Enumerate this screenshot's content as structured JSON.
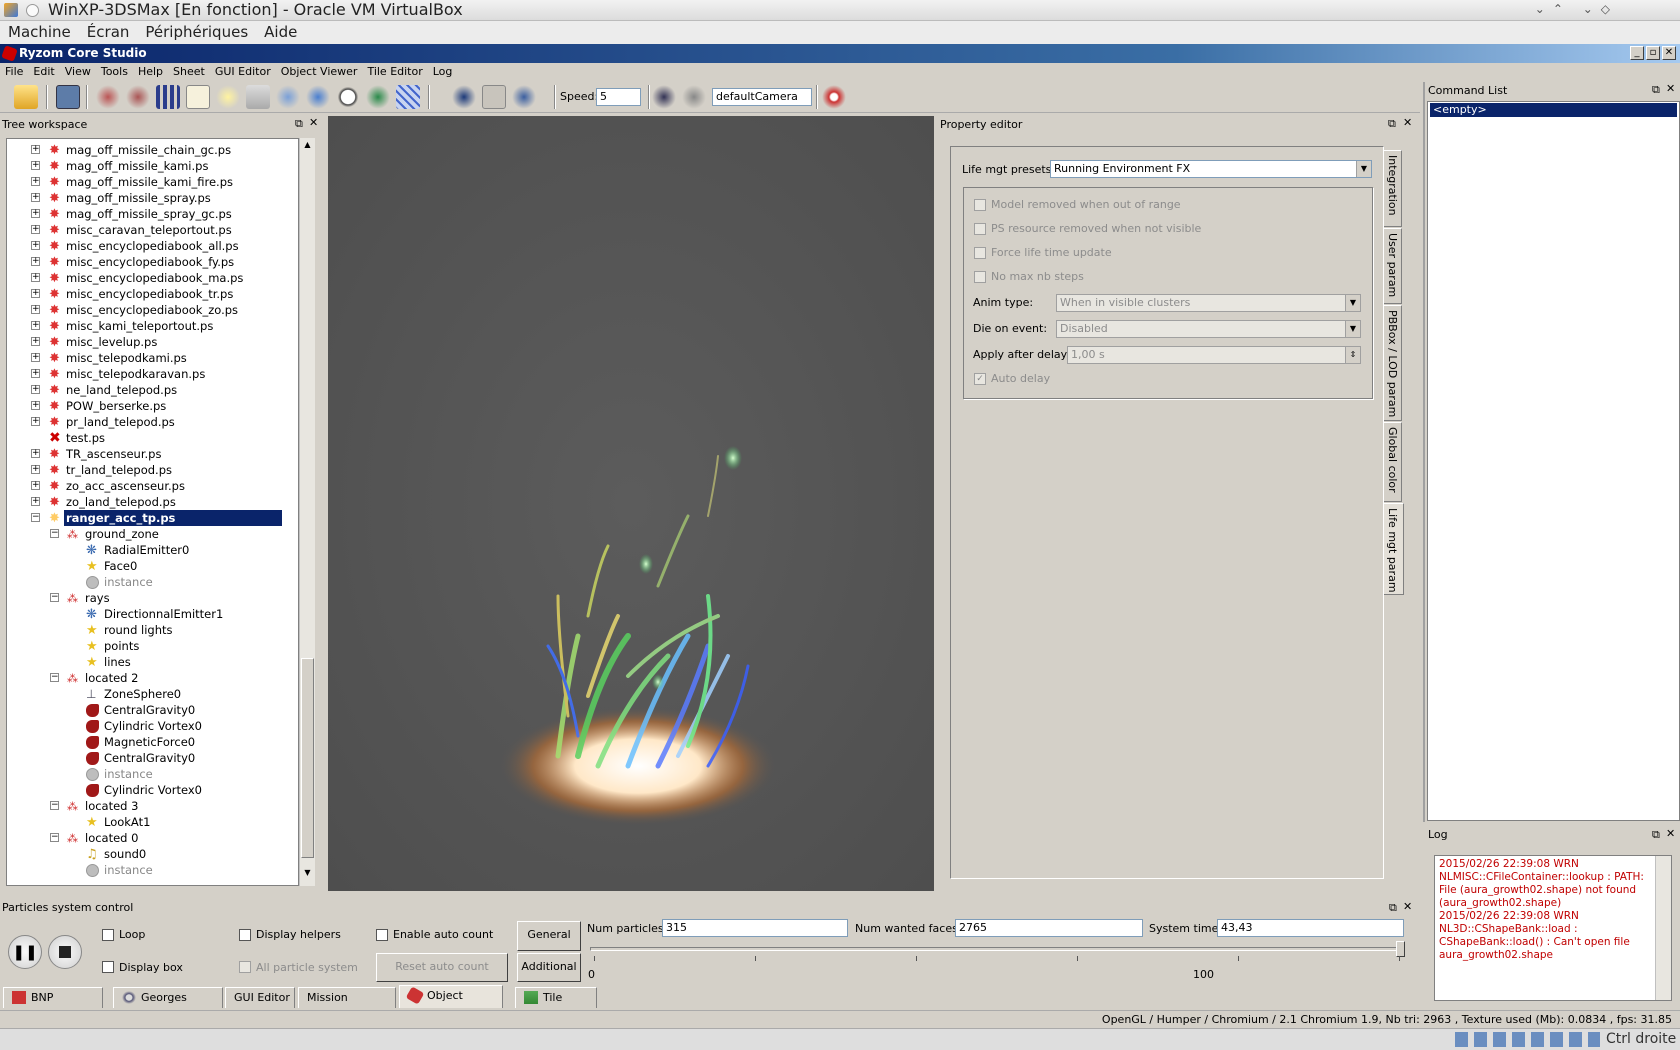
{
  "vbox": {
    "title": "WinXP-3DSMax [En fonction] - Oracle VM VirtualBox",
    "menu": [
      "Machine",
      "Écran",
      "Périphériques",
      "Aide"
    ]
  },
  "app": {
    "title": "Ryzom Core Studio",
    "menu": [
      "File",
      "Edit",
      "View",
      "Tools",
      "Help",
      "Sheet",
      "GUI Editor",
      "Object Viewer",
      "Tile Editor",
      "Log"
    ]
  },
  "toolbar": {
    "speed_label": "Speed:",
    "speed_value": "5",
    "camera": "defaultCamera"
  },
  "tree": {
    "title": "Tree workspace",
    "files": [
      "mag_off_missile_chain_gc.ps",
      "mag_off_missile_kami.ps",
      "mag_off_missile_kami_fire.ps",
      "mag_off_missile_spray.ps",
      "mag_off_missile_spray_gc.ps",
      "misc_caravan_teleportout.ps",
      "misc_encyclopediabook_all.ps",
      "misc_encyclopediabook_fy.ps",
      "misc_encyclopediabook_ma.ps",
      "misc_encyclopediabook_tr.ps",
      "misc_encyclopediabook_zo.ps",
      "misc_kami_teleportout.ps",
      "misc_levelup.ps",
      "misc_telepodkami.ps",
      "misc_telepodkaravan.ps",
      "ne_land_telepod.ps",
      "POW_berserke.ps",
      "pr_land_telepod.ps",
      "test.ps",
      "TR_ascenseur.ps",
      "tr_land_telepod.ps",
      "zo_acc_ascenseur.ps",
      "zo_land_telepod.ps"
    ],
    "selected": "ranger_acc_tp.ps",
    "children": [
      {
        "label": "ground_zone",
        "level": 1,
        "icon": "located"
      },
      {
        "label": "RadialEmitter0",
        "level": 2,
        "icon": "emitter"
      },
      {
        "label": "Face0",
        "level": 2,
        "icon": "star"
      },
      {
        "label": "instance",
        "level": 2,
        "icon": "instance"
      },
      {
        "label": "rays",
        "level": 1,
        "icon": "located"
      },
      {
        "label": "DirectionnalEmitter1",
        "level": 2,
        "icon": "emitter"
      },
      {
        "label": "round lights",
        "level": 2,
        "icon": "star"
      },
      {
        "label": "points",
        "level": 2,
        "icon": "star"
      },
      {
        "label": "lines",
        "level": 2,
        "icon": "star"
      },
      {
        "label": "located 2",
        "level": 1,
        "icon": "located"
      },
      {
        "label": "ZoneSphere0",
        "level": 2,
        "icon": "zone"
      },
      {
        "label": "CentralGravity0",
        "level": 2,
        "icon": "force"
      },
      {
        "label": "Cylindric Vortex0",
        "level": 2,
        "icon": "force"
      },
      {
        "label": "MagneticForce0",
        "level": 2,
        "icon": "force"
      },
      {
        "label": "CentralGravity0",
        "level": 2,
        "icon": "force"
      },
      {
        "label": "instance",
        "level": 2,
        "icon": "instance"
      },
      {
        "label": "Cylindric Vortex0",
        "level": 2,
        "icon": "force"
      },
      {
        "label": "located 3",
        "level": 1,
        "icon": "located"
      },
      {
        "label": "LookAt1",
        "level": 2,
        "icon": "star"
      },
      {
        "label": "located 0",
        "level": 1,
        "icon": "located"
      },
      {
        "label": "sound0",
        "level": 2,
        "icon": "sound"
      },
      {
        "label": "instance",
        "level": 2,
        "icon": "instance"
      }
    ]
  },
  "props": {
    "title": "Property editor",
    "preset_label": "Life mgt presets:",
    "preset_value": "Running Environment FX",
    "checks": [
      "Model removed when out of range",
      "PS resource removed when not visible",
      "Force life time update",
      "No max nb steps"
    ],
    "anim_label": "Anim type:",
    "anim_value": "When in visible clusters",
    "die_label": "Die on event:",
    "die_value": "Disabled",
    "delay_label": "Apply after delay:",
    "delay_value": "1,00 s",
    "auto_delay": "Auto delay",
    "tabs": [
      "Integration",
      "User param",
      "PBBox / LOD param",
      "Global color",
      "Life mgt param"
    ]
  },
  "cmd": {
    "title": "Command List",
    "item": "<empty>"
  },
  "log": {
    "title": "Log",
    "lines": [
      "2015/02/26 22:39:08 WRN",
      "NLMISC::CFileContainer::lookup : PATH:",
      "File (aura_growth02.shape) not found",
      "(aura_growth02.shape)",
      "2015/02/26 22:39:08 WRN",
      "NL3D::CShapeBank::load :",
      "CShapeBank::load() : Can't open file",
      "aura_growth02.shape"
    ]
  },
  "psc": {
    "title": "Particles system control",
    "loop": "Loop",
    "display_box": "Display box",
    "display_helpers": "Display helpers",
    "all_ps": "All particle system",
    "enable_auto": "Enable auto count",
    "reset_auto": "Reset auto count",
    "general": "General",
    "additional": "Additional",
    "num_particles_label": "Num particles:",
    "num_particles": "315",
    "num_faces_label": "Num wanted faces:",
    "num_faces": "2765",
    "sys_time_label": "System time:",
    "sys_time": "43,43",
    "scale_min": "0",
    "scale_mid": "100"
  },
  "bottom_tabs": [
    "BNP Manager",
    "Georges Editor",
    "GUI Editor",
    "Mission Compiler",
    "Object Viewer",
    "Tile Editor"
  ],
  "status": "OpenGL / Humper / Chromium / 2.1 Chromium 1.9, Nb tri: 2963 , Texture used (Mb): 0.0834 , fps: 31.85",
  "host": {
    "key": "Ctrl droite"
  }
}
